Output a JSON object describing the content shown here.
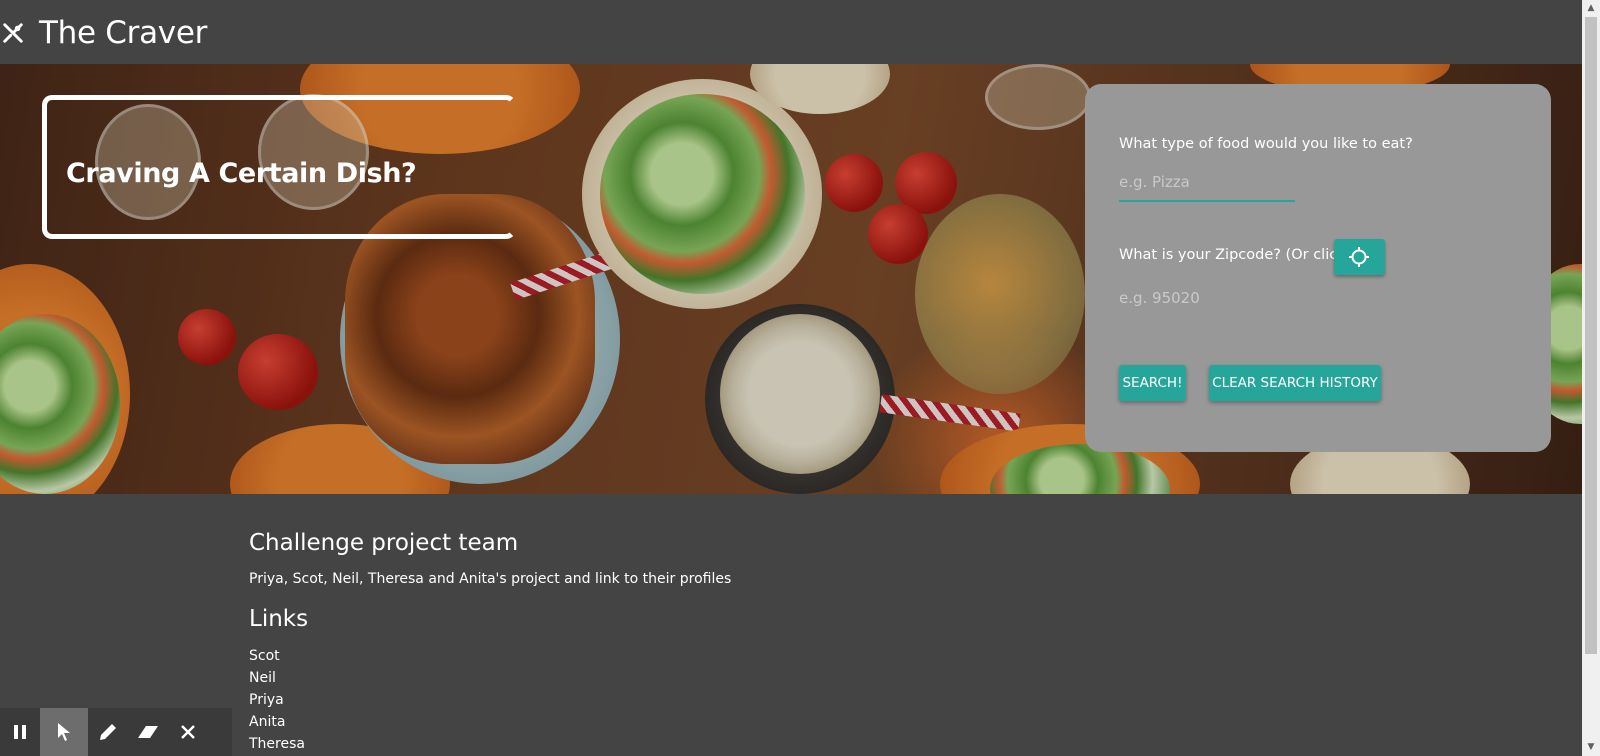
{
  "app": {
    "title": "The Craver"
  },
  "hero": {
    "callout_title": "Craving A Certain Dish?"
  },
  "search": {
    "food_question": "What type of food would you like to eat?",
    "food_placeholder": "e.g. Pizza",
    "zip_question": "What is your Zipcode? (Or click)",
    "zip_placeholder": "e.g. 95020",
    "search_label": "SEARCH!",
    "clear_label": "CLEAR SEARCH HISTORY",
    "accent_color": "#26a69a"
  },
  "about": {
    "heading": "Challenge project team",
    "description": "Priya, Scot, Neil, Theresa and Anita's project and link to their profiles"
  },
  "links": {
    "heading": "Links",
    "items": [
      "Scot",
      "Neil",
      "Priya",
      "Anita",
      "Theresa"
    ]
  },
  "toolbar": {
    "icons": [
      "pause-icon",
      "cursor-icon",
      "pencil-icon",
      "eraser-icon",
      "close-icon"
    ]
  }
}
